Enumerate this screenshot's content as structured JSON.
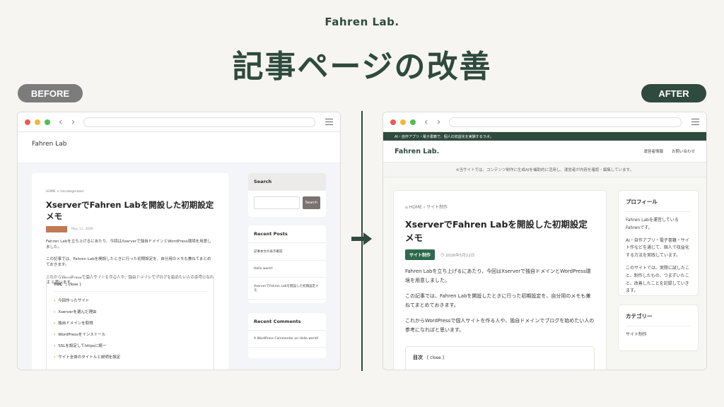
{
  "brand": "Fahren Lab.",
  "headline": "記事ページの改善",
  "labels": {
    "before": "BEFORE",
    "after": "AFTER"
  },
  "colors": {
    "accent": "#2f4a3e",
    "before_pill": "#7c7c7c",
    "before_category": "#c07a55",
    "after_category": "#2f6a4e"
  },
  "before": {
    "site_title": "Fahren Lab",
    "breadcrumb": "HOME  >  Uncategorized",
    "article_title": "XserverでFahren Labを開設した初期設定メモ",
    "date": "May 11, 2026",
    "paragraphs": [
      "Fahren Labを立ち上げるにあたり、今回はXserverで独自ドメインとWordPress環境を用意しました。",
      "この記事では、Fahren Labを開設したときに行った初期設定を、自分用のメモも兼ねてまとめておきます。",
      "これからWordPressで個人サイトを作る人や、独自ドメインでブログを始めたい人の参考になれば と思います。"
    ],
    "toc": {
      "title": "TOC",
      "toggle": "[ close ]",
      "items": [
        "今回作ったサイト",
        "Xserverを選んだ理由",
        "独自ドメインを取得",
        "WordPressをインストール",
        "SSLを設定してhttpsに統一",
        "サイト全体のタイトルと説明を設定"
      ]
    },
    "sidebar": {
      "search_title": "Search",
      "search_button": "Search",
      "recent_posts_title": "Recent Posts",
      "recent_posts": [
        "記事本文の表示確認",
        "Hello world!",
        "XserverでFahren Labを開設した初期設定メモ"
      ],
      "recent_comments_title": "Recent Comments",
      "recent_comments": [
        "A WordPress Commenter on Hello world!"
      ]
    }
  },
  "after": {
    "tagline": "AI・自作アプリ・電子書籍で、個人の収益化を実験するラボ。",
    "logo": "Fahren Lab.",
    "nav": [
      "運営者情報",
      "お問い合わせ"
    ],
    "notice": "※当サイトでは、コンテンツ制作に生成AIを補助的に活用し、運営者が内容を確認・編集しています。",
    "breadcrumb": "HOME  ›  サイト制作",
    "article_title": "XserverでFahren Labを開設した初期設定メモ",
    "category": "サイト制作",
    "date": "2026年5月11日",
    "paragraphs": [
      "Fahren Labを立ち上げるにあたり、今回はXserverで独自ドメインとWordPress環境を用意しました。",
      "この記事では、Fahren Labを開設したときに行った初期設定を、自分用のメモも兼ねてまとめておきます。",
      "これからWordPressで個人サイトを作る人や、独自ドメインでブログを始めたい人の参考になればと思います。"
    ],
    "toc": {
      "title": "目次",
      "toggle": "[ close ]"
    },
    "sidebar": {
      "profile_title": "プロフィール",
      "profile_paragraphs": [
        "Fahren Labを運営しているFahrenです。",
        "AI・自作アプリ・電子書籍・サイト作などを通じて、個人で収益化する方法を実践しています。",
        "このサイトでは、実際に試したこと、制作したもの、つまずいたこと、改善したことを記録していきます。"
      ],
      "category_title": "カテゴリー",
      "categories": [
        "サイト制作"
      ]
    }
  }
}
